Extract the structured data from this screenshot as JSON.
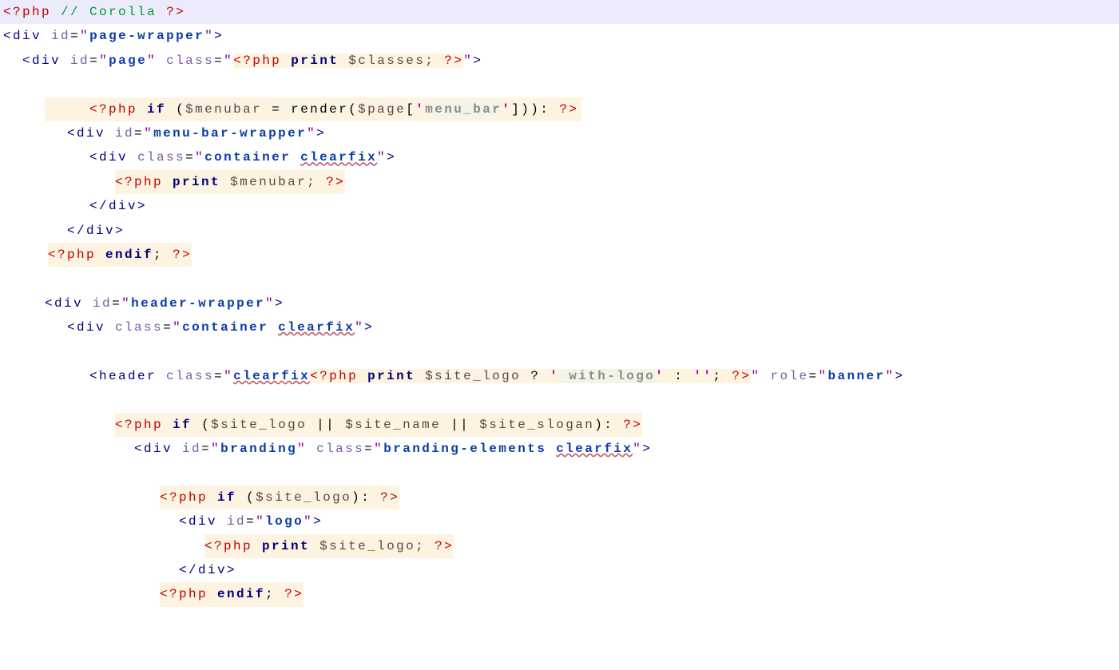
{
  "l1": {
    "open": "<?php",
    "comment": "// Corolla",
    "close": "?>"
  },
  "l2": {
    "lt": "<",
    "tag": "div",
    "attr": "id",
    "eq": "=",
    "q": "\"",
    "val": "page-wrapper",
    "gt": ">"
  },
  "l3": {
    "lt": "<",
    "tag": "div",
    "id": "id",
    "eq": "=",
    "q": "\"",
    "idval": "page",
    "cls": "class",
    "php": "<?php",
    "kw": "print",
    "var": "$classes;",
    "clo": "?>",
    "gt": ">"
  },
  "l4": {
    "open": "<?php",
    "kw": "if",
    "lp": "(",
    "var1": "$menubar",
    "asn": "=",
    "fn": "render",
    "lp2": "(",
    "var2": "$page",
    "lb": "[",
    "sq": "'",
    "str": "menu_bar",
    "rb": "]",
    "rp2": ")",
    "rp": ")",
    "colon": ":",
    "close": "?>"
  },
  "l5": {
    "lt": "<",
    "tag": "div",
    "attr": "id",
    "eq": "=",
    "q": "\"",
    "val": "menu-bar-wrapper",
    "gt": ">"
  },
  "l6": {
    "lt": "<",
    "tag": "div",
    "attr": "class",
    "eq": "=",
    "q": "\"",
    "val": "container ",
    "sp": "clearfix",
    "gt": ">"
  },
  "l7": {
    "open": "<?php",
    "kw": "print",
    "var": "$menubar;",
    "close": "?>"
  },
  "l8": {
    "lt": "<",
    "sl": "/",
    "tag": "div",
    "gt": ">"
  },
  "l9": {
    "lt": "<",
    "sl": "/",
    "tag": "div",
    "gt": ">"
  },
  "l10": {
    "open": "<?php",
    "kw": "endif",
    "semi": ";",
    "close": "?>"
  },
  "l11": {
    "lt": "<",
    "tag": "div",
    "attr": "id",
    "eq": "=",
    "q": "\"",
    "val": "header-wrapper",
    "gt": ">"
  },
  "l12": {
    "lt": "<",
    "tag": "div",
    "attr": "class",
    "eq": "=",
    "q": "\"",
    "val": "container ",
    "sp": "clearfix",
    "gt": ">"
  },
  "l13": {
    "lt": "<",
    "tag": "header",
    "attr": "class",
    "eq": "=",
    "q": "\"",
    "sp": "clearfix",
    "open": "<?php",
    "kw": "print",
    "var": "$site_logo",
    "tern": "?",
    "sq": "'",
    "str": " with-logo",
    "colon": ":",
    "str2": "",
    "semi": ";",
    "close": "?>",
    "role": "role",
    "roleval": "banner",
    "gt": ">"
  },
  "l14": {
    "open": "<?php",
    "kw": "if",
    "lp": "(",
    "v1": "$site_logo",
    "or": "||",
    "v2": "$site_name",
    "v3": "$site_slogan",
    "rp": ")",
    "colon": ":",
    "close": "?>"
  },
  "l15": {
    "lt": "<",
    "tag": "div",
    "id": "id",
    "eq": "=",
    "q": "\"",
    "idval": "branding",
    "cls": "class",
    "clsval": "branding-elements ",
    "sp": "clearfix",
    "gt": ">"
  },
  "l16": {
    "open": "<?php",
    "kw": "if",
    "lp": "(",
    "v": "$site_logo",
    "rp": ")",
    "colon": ":",
    "close": "?>"
  },
  "l17": {
    "lt": "<",
    "tag": "div",
    "attr": "id",
    "eq": "=",
    "q": "\"",
    "val": "logo",
    "gt": ">"
  },
  "l18": {
    "open": "<?php",
    "kw": "print",
    "var": "$site_logo;",
    "close": "?>"
  },
  "l19": {
    "lt": "<",
    "sl": "/",
    "tag": "div",
    "gt": ">"
  },
  "l20": {
    "open": "<?php",
    "kw": "endif",
    "semi": ";",
    "close": "?>"
  }
}
